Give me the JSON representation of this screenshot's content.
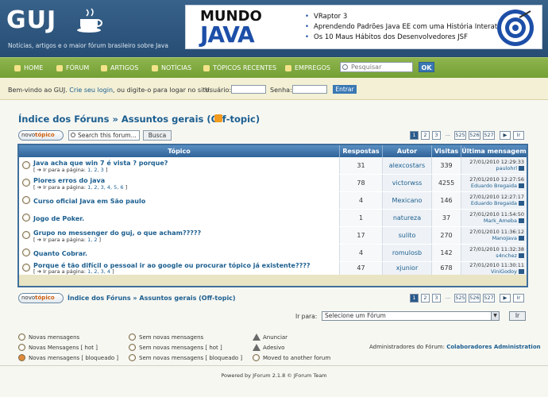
{
  "header": {
    "logo": "GUJ",
    "tagline": "Notícias, artigos e o maior fórum brasileiro sobre Java",
    "banner": {
      "title1": "MUNDO",
      "title2": "JAVA",
      "items": [
        "VRaptor 3",
        "Aprendendo Padrões Java EE com uma História Interativa",
        "Os 10 Maus Hábitos dos Desenvolvedores JSF"
      ]
    }
  },
  "nav": {
    "items": [
      "HOME",
      "FÓRUM",
      "ARTIGOS",
      "NOTÍCIAS",
      "TÓPICOS RECENTES",
      "EMPREGOS"
    ],
    "search_placeholder": "Pesquisar",
    "ok_label": "OK"
  },
  "login": {
    "welcome_pre": "Bem-vindo ao GUJ.",
    "signup_link": "Crie seu login",
    "welcome_post": ", ou digite-o para logar no site.",
    "user_label": "Usuário:",
    "pass_label": "Senha:",
    "enter_label": "Entrar"
  },
  "forum": {
    "index_link": "Índice dos Fóruns",
    "separator": "»",
    "forum_name": "Assuntos gerais (Off-topic)",
    "new_topic_pre": "novo",
    "new_topic_post": "tópico",
    "search_placeholder": "Search this forum...",
    "search_button": "Busca",
    "pages": [
      "1",
      "2",
      "3",
      "...",
      "525",
      "526",
      "527"
    ],
    "next_label": "▶",
    "go_label": "Ir"
  },
  "table": {
    "headers": [
      "Tópico",
      "Respostas",
      "Autor",
      "Visitas",
      "Última mensagem"
    ],
    "goto_prefix": "[ ➔ Ir para a página:",
    "goto_suffix": "]",
    "rows": [
      {
        "title": "Java acha que win 7 é vista ? porque?",
        "pages": "1, 2, 3",
        "replies": "31",
        "author": "alexcostars",
        "views": "339",
        "last_date": "27/01/2010 12:29:33",
        "last_user": "paulohrl"
      },
      {
        "title": "Piores erros do java",
        "pages": "1, 2, 3, 4, 5, 6",
        "replies": "78",
        "author": "victorwss",
        "views": "4255",
        "last_date": "27/01/2010 12:27:56",
        "last_user": "Eduardo Bregaida"
      },
      {
        "title": "Curso oficial Java em São paulo",
        "pages": "",
        "replies": "4",
        "author": "Mexicano",
        "views": "146",
        "last_date": "27/01/2010 12:27:17",
        "last_user": "Eduardo Bregaida"
      },
      {
        "title": "Jogo de Poker.",
        "pages": "",
        "replies": "1",
        "author": "natureza",
        "views": "37",
        "last_date": "27/01/2010 11:54:50",
        "last_user": "Mark_Ameba"
      },
      {
        "title": "Grupo no messenger do guj, o que acham?????",
        "pages": "1, 2",
        "replies": "17",
        "author": "sulito",
        "views": "270",
        "last_date": "27/01/2010 11:36:12",
        "last_user": "ManoJava"
      },
      {
        "title": "Quanto Cobrar.",
        "pages": "",
        "replies": "4",
        "author": "romulosb",
        "views": "142",
        "last_date": "27/01/2010 11:32:38",
        "last_user": "s4nchez"
      },
      {
        "title": "Porque é tão difícil o pessoal ir ao google ou procurar tópico já existente????",
        "pages": "1, 2, 3, 4",
        "replies": "47",
        "author": "xjunior",
        "views": "678",
        "last_date": "27/01/2010 11:30:11",
        "last_user": "ViniGodoy"
      }
    ]
  },
  "bottom": {
    "goto_label": "Ir para:",
    "select_value": "Selecione um Fórum",
    "goto_button": "Ir",
    "legend": [
      "Novas mensagens",
      "Novas Mensagens [ hot ]",
      "Novas mensagens [ bloqueado ]",
      "Sem novas mensagens",
      "Sem novas mensagens [ hot ]",
      "Sem novas mensagens [ bloqueado ]",
      "Anunciar",
      "Adesivo",
      "Moved to another forum"
    ],
    "admins_label": "Administradores do Fórum:",
    "admins_value": "Colaboradores Administration",
    "powered": "Powered by JForum 2.1.8 © JForum Team"
  },
  "colors": {
    "header": "#2f5a82",
    "nav": "#7fa840",
    "link": "#1b5e8f",
    "table_border": "#3f6f9c"
  }
}
